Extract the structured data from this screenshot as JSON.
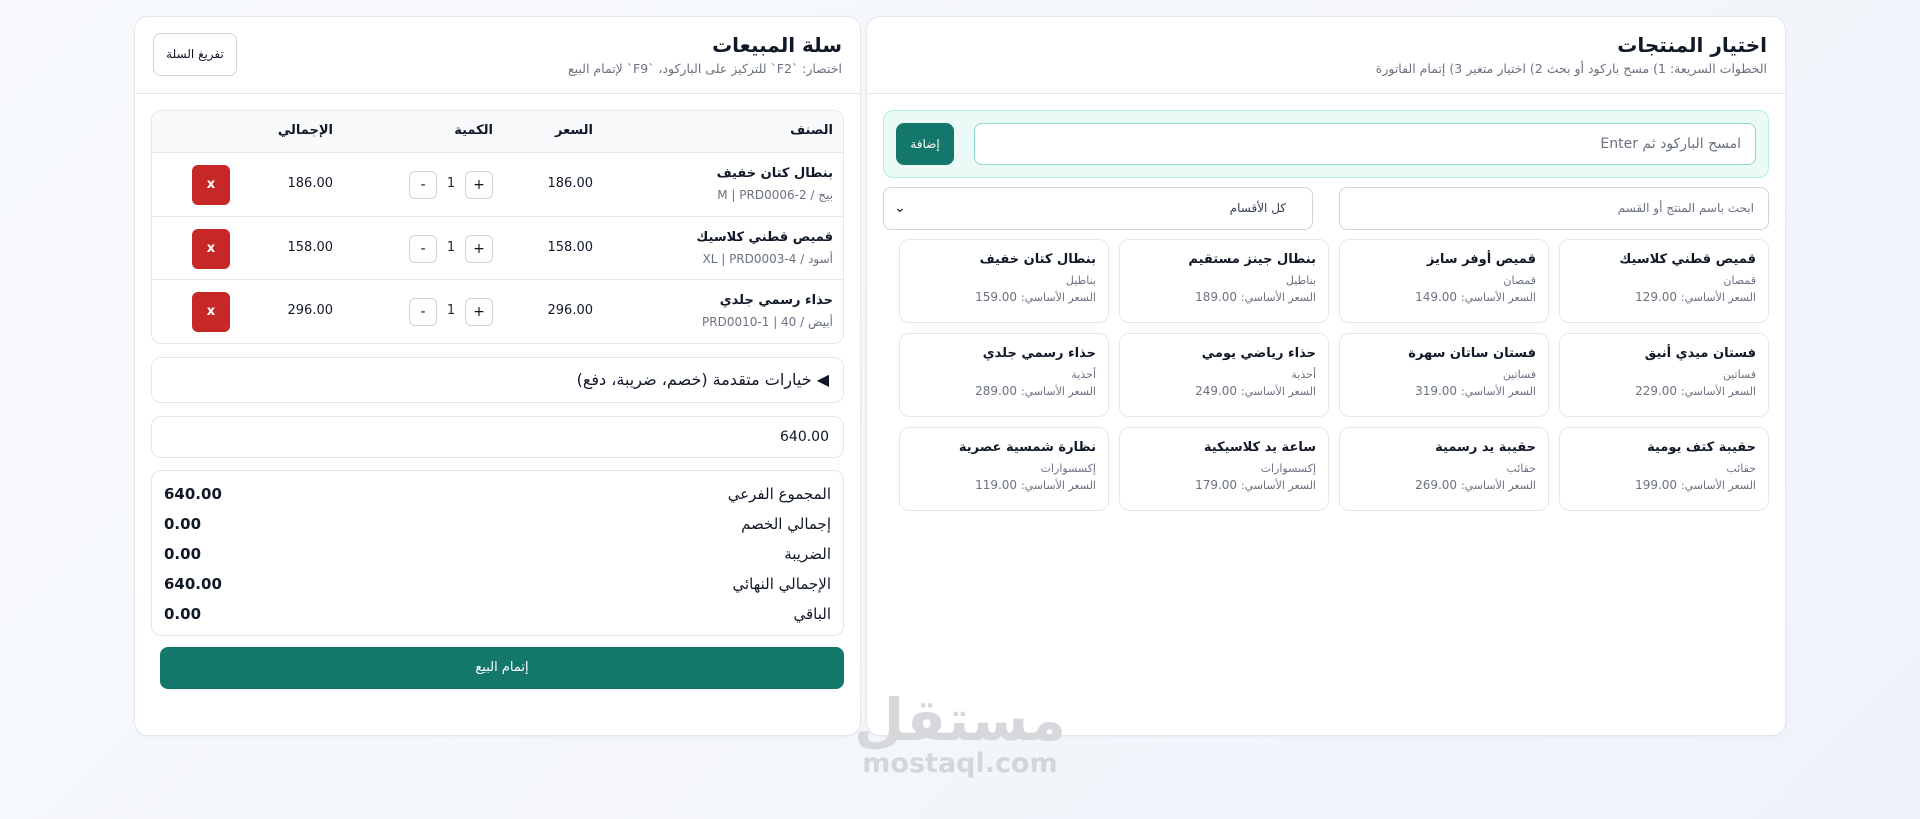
{
  "products_panel": {
    "title": "اختيار المنتجات",
    "subtitle": "الخطوات السريعة: 1) مسح باركود أو بحث 2) اختيار متغير 3) إتمام الفاتورة",
    "barcode_placeholder": "امسح الباركود ثم Enter",
    "add_button": "إضافة",
    "search_placeholder": "ابحث باسم المنتج أو القسم",
    "category_selected": "كل الأقسام",
    "price_label": "السعر الأساسي:",
    "products": [
      {
        "name": "قميص قطني كلاسيك",
        "category": "قمصان",
        "price": "129.00"
      },
      {
        "name": "قميص أوفر سايز",
        "category": "قمصان",
        "price": "149.00"
      },
      {
        "name": "بنطال جينز مستقيم",
        "category": "بناطيل",
        "price": "189.00"
      },
      {
        "name": "بنطال كتان خفيف",
        "category": "بناطيل",
        "price": "159.00"
      },
      {
        "name": "فستان ميدي أنيق",
        "category": "فساتين",
        "price": "229.00"
      },
      {
        "name": "فستان ساتان سهرة",
        "category": "فساتين",
        "price": "319.00"
      },
      {
        "name": "حذاء رياضي يومي",
        "category": "أحذية",
        "price": "249.00"
      },
      {
        "name": "حذاء رسمي جلدي",
        "category": "أحذية",
        "price": "289.00"
      },
      {
        "name": "حقيبة كتف يومية",
        "category": "حقائب",
        "price": "199.00"
      },
      {
        "name": "حقيبة يد رسمية",
        "category": "حقائب",
        "price": "269.00"
      },
      {
        "name": "ساعة يد كلاسيكية",
        "category": "إكسسوارات",
        "price": "179.00"
      },
      {
        "name": "نظارة شمسية عصرية",
        "category": "إكسسوارات",
        "price": "119.00"
      }
    ]
  },
  "cart_panel": {
    "title": "سلة المبيعات",
    "subtitle": "اختصار: `F2` للتركيز على الباركود، `F9` لإتمام البيع",
    "clear_button": "تفريغ السلة",
    "columns": {
      "item": "الصنف",
      "price": "السعر",
      "qty": "الكمية",
      "total": "الإجمالي"
    },
    "items": [
      {
        "name": "بنطال كتان خفيف",
        "meta": "بيج / M | PRD0006-2",
        "price": "186.00",
        "qty": "1",
        "total": "186.00"
      },
      {
        "name": "قميص قطني كلاسيك",
        "meta": "أسود / XL | PRD0003-4",
        "price": "158.00",
        "qty": "1",
        "total": "158.00"
      },
      {
        "name": "حذاء رسمي جلدي",
        "meta": "أبيض / 40 | PRD0010-1",
        "price": "296.00",
        "qty": "1",
        "total": "296.00"
      }
    ],
    "plus_label": "+",
    "minus_label": "-",
    "remove_label": "x",
    "advanced_options": "◀ خيارات متقدمة (خصم، ضريبة، دفع)",
    "paid_amount": "640.00",
    "summary": {
      "subtotal_label": "المجموع الفرعي",
      "subtotal": "640.00",
      "discount_label": "إجمالي الخصم",
      "discount": "0.00",
      "tax_label": "الضريبة",
      "tax": "0.00",
      "grand_total_label": "الإجمالي النهائي",
      "grand_total": "640.00",
      "remaining_label": "الباقي",
      "remaining": "0.00"
    },
    "checkout_button": "إتمام البيع"
  },
  "watermark": {
    "logo": "مستقل",
    "url": "mostaql.com"
  },
  "colors": {
    "primary": "#13776b",
    "danger": "#c62828",
    "barcode_bg": "#eafbf7"
  }
}
